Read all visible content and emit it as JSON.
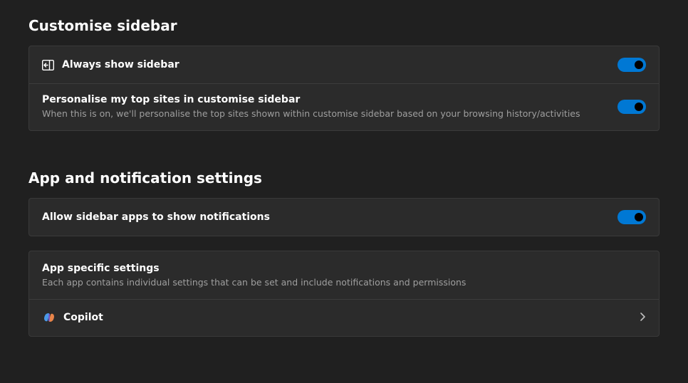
{
  "customise_sidebar": {
    "title": "Customise sidebar",
    "always_show": {
      "label": "Always show sidebar",
      "toggle": true
    },
    "personalise": {
      "label": "Personalise my top sites in customise sidebar",
      "desc": "When this is on, we'll personalise the top sites shown within customise sidebar based on your browsing history/activities",
      "toggle": true
    }
  },
  "app_notification": {
    "title": "App and notification settings",
    "allow_notifications": {
      "label": "Allow sidebar apps to show notifications",
      "toggle": true
    },
    "app_specific": {
      "title": "App specific settings",
      "desc": "Each app contains individual settings that can be set and include notifications and permissions",
      "items": [
        {
          "name": "Copilot"
        }
      ]
    }
  }
}
